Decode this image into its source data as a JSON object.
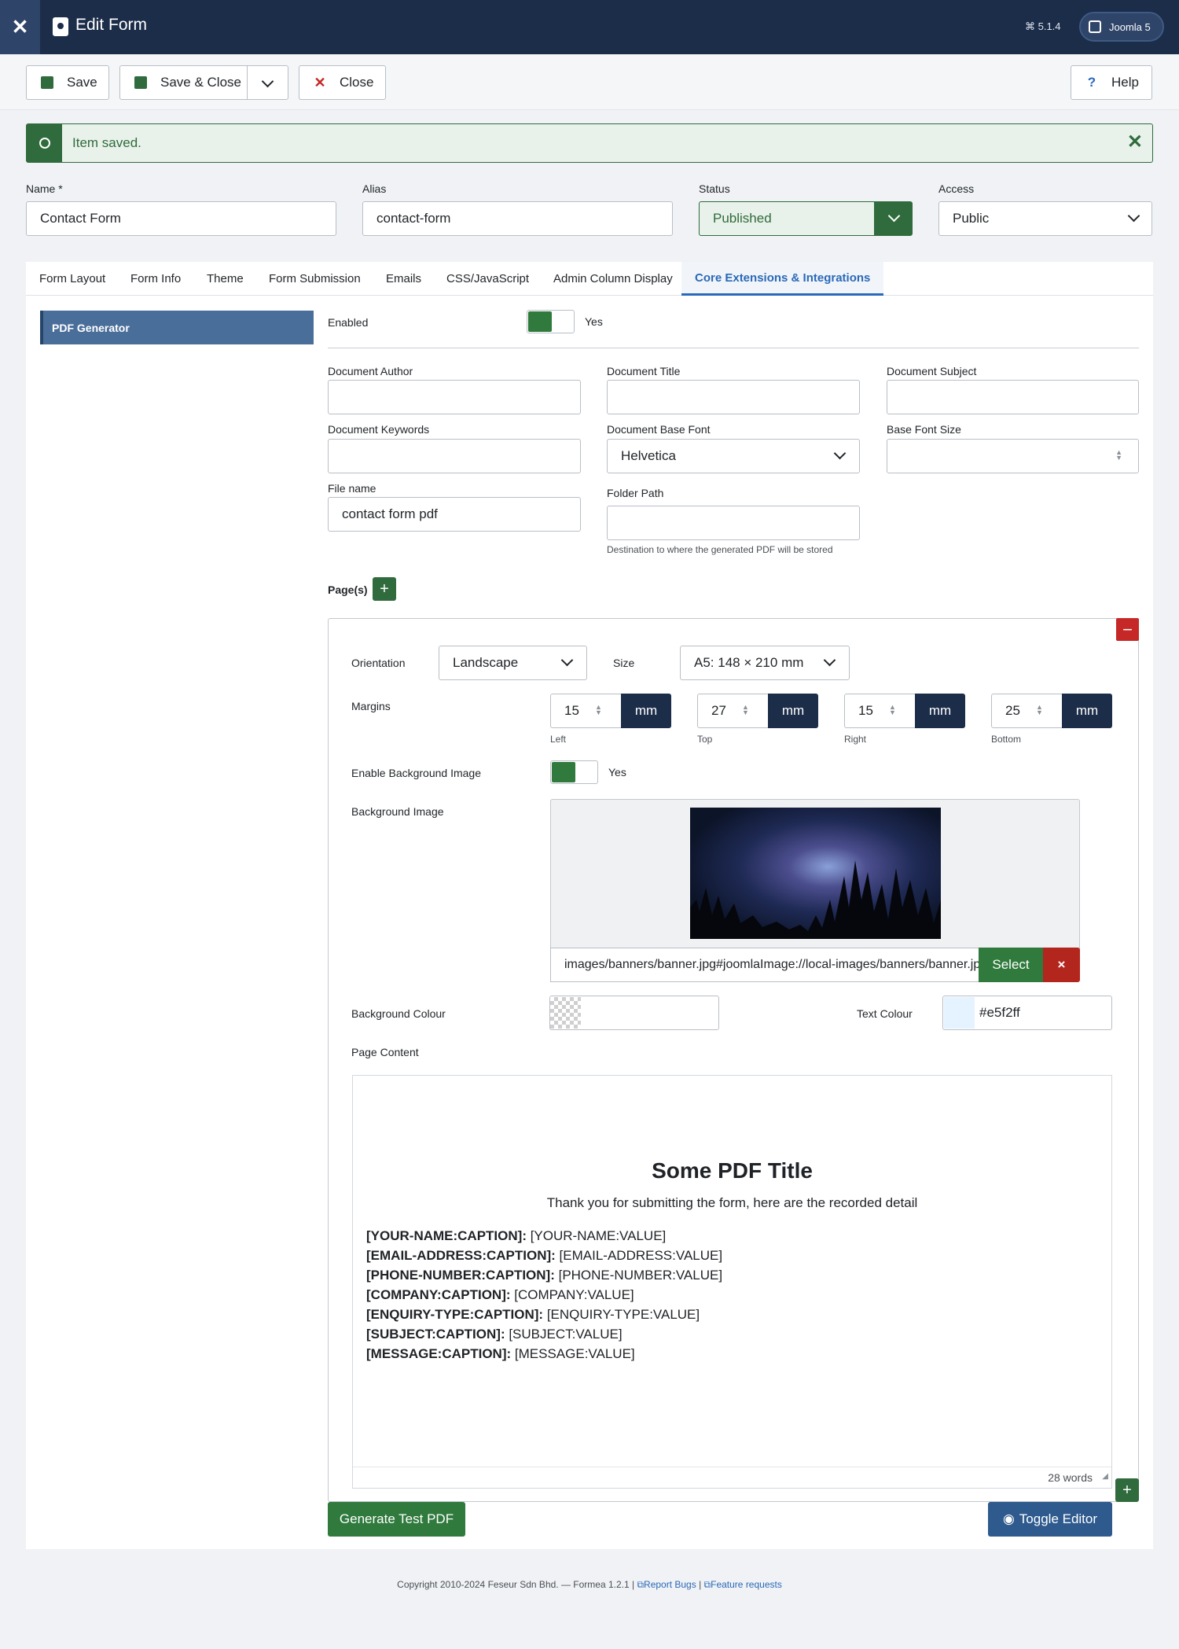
{
  "header": {
    "title": "Edit Form",
    "version": "⌘ 5.1.4",
    "site_button": "Joomla 5"
  },
  "toolbar": {
    "save": "Save",
    "save_close": "Save & Close",
    "close": "Close",
    "help": "Help"
  },
  "alert": {
    "message": "Item saved."
  },
  "fields": {
    "name_label": "Name *",
    "name_value": "Contact Form",
    "alias_label": "Alias",
    "alias_value": "contact-form",
    "status_label": "Status",
    "status_value": "Published",
    "access_label": "Access",
    "access_value": "Public"
  },
  "tabs": [
    "Form Layout",
    "Form Info",
    "Theme",
    "Form Submission",
    "Emails",
    "CSS/JavaScript",
    "Admin Column Display",
    "Core Extensions & Integrations"
  ],
  "active_tab": "Core Extensions & Integrations",
  "sidebar": {
    "items": [
      "PDF Generator"
    ]
  },
  "pdf": {
    "enabled_label": "Enabled",
    "enabled_value": "Yes",
    "author_label": "Document Author",
    "author_value": "",
    "title_label": "Document Title",
    "title_value": "",
    "subject_label": "Document Subject",
    "subject_value": "",
    "keywords_label": "Document Keywords",
    "keywords_value": "",
    "font_label": "Document Base Font",
    "font_value": "Helvetica",
    "font_size_label": "Base Font Size",
    "font_size_value": "",
    "filename_label": "File name",
    "filename_value": "contact form pdf",
    "folder_label": "Folder Path",
    "folder_value": "",
    "folder_help": "Destination to where the generated PDF will be stored",
    "pages_label": "Page(s)"
  },
  "page": {
    "orientation_label": "Orientation",
    "orientation_value": "Landscape",
    "size_label": "Size",
    "size_value": "A5: 148 × 210 mm",
    "margins_label": "Margins",
    "margins": [
      {
        "value": "15",
        "unit": "mm",
        "caption": "Left"
      },
      {
        "value": "27",
        "unit": "mm",
        "caption": "Top"
      },
      {
        "value": "15",
        "unit": "mm",
        "caption": "Right"
      },
      {
        "value": "25",
        "unit": "mm",
        "caption": "Bottom"
      }
    ],
    "bg_image_enable_label": "Enable Background Image",
    "bg_image_enable_value": "Yes",
    "bg_image_label": "Background Image",
    "bg_image_path": "images/banners/banner.jpg#joomlaImage://local-images/banners/banner.jpg?width=1920&height=1080",
    "select_label": "Select",
    "delete_label": "×",
    "bg_colour_label": "Background Colour",
    "bg_colour_value": "",
    "text_colour_label": "Text Colour",
    "text_colour_value": "#e5f2ff",
    "content_label": "Page Content"
  },
  "editor": {
    "heading": "Some PDF Title",
    "intro": "Thank you for submitting the form, here are the recorded detail",
    "lines": [
      {
        "caption": "[YOUR-NAME:CAPTION]:",
        "value": " [YOUR-NAME:VALUE]"
      },
      {
        "caption": "[EMAIL-ADDRESS:CAPTION]:",
        "value": " [EMAIL-ADDRESS:VALUE]"
      },
      {
        "caption": "[PHONE-NUMBER:CAPTION]:",
        "value": " [PHONE-NUMBER:VALUE]"
      },
      {
        "caption": "[COMPANY:CAPTION]:",
        "value": " [COMPANY:VALUE]"
      },
      {
        "caption": "[ENQUIRY-TYPE:CAPTION]:",
        "value": " [ENQUIRY-TYPE:VALUE]"
      },
      {
        "caption": "[SUBJECT:CAPTION]:",
        "value": " [SUBJECT:VALUE]"
      },
      {
        "caption": "[MESSAGE:CAPTION]:",
        "value": " [MESSAGE:VALUE]"
      }
    ],
    "word_count": "28 words"
  },
  "actions": {
    "generate": "Generate Test PDF",
    "toggle": "Toggle Editor"
  },
  "footer": {
    "copyright": "Copyright 2010-2024 Feseur Sdn Bhd. — Formea 1.2.1 |",
    "report": "Report Bugs",
    "separator": "|",
    "feature": "Feature requests"
  },
  "colors": {
    "header": "#1c2d49",
    "success": "#2f6b3c",
    "danger": "#c52827",
    "accent": "#2a69b8"
  }
}
